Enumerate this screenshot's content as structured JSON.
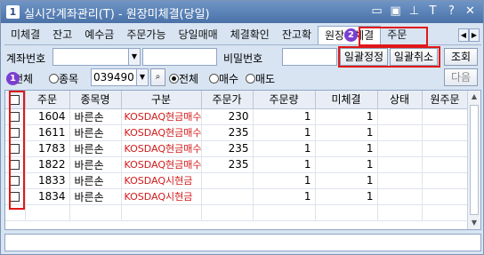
{
  "window": {
    "number": "1",
    "title": "실시간계좌관리(T) - 원장미체결(당일)",
    "title_icons": [
      "restore-icon",
      "dock-icon",
      "pin-icon",
      "font-icon",
      "help-icon",
      "close-icon"
    ]
  },
  "tabs": [
    "미체결",
    "잔고",
    "예수금",
    "주문가능",
    "당일매매",
    "체결확인",
    "잔고확",
    "원장미체결",
    "주문"
  ],
  "active_tab": "원장미체결",
  "form": {
    "account_label": "계좌번호",
    "password_label": "비밀번호",
    "batch_correct": "일괄정정",
    "batch_cancel": "일괄취소",
    "query": "조회",
    "scope_all": "전체",
    "scope_item": "종목",
    "code_value": "039490",
    "side_all": "전체",
    "side_buy": "매수",
    "side_sell": "매도",
    "next": "다음"
  },
  "badges": {
    "one": "1",
    "two": "2"
  },
  "table": {
    "headers": [
      "주문",
      "종목명",
      "구분",
      "주문가",
      "주문량",
      "미체결",
      "상태",
      "원주문"
    ],
    "rows": [
      [
        "1604",
        "바른손",
        "KOSDAQ현금매수",
        "230",
        "1",
        "1",
        "",
        ""
      ],
      [
        "1611",
        "바른손",
        "KOSDAQ현금매수",
        "235",
        "1",
        "1",
        "",
        ""
      ],
      [
        "1783",
        "바른손",
        "KOSDAQ현금매수",
        "235",
        "1",
        "1",
        "",
        ""
      ],
      [
        "1822",
        "바른손",
        "KOSDAQ현금매수",
        "235",
        "1",
        "1",
        "",
        ""
      ],
      [
        "1833",
        "바른손",
        "KOSDAQ시현금",
        "",
        "1",
        "1",
        "",
        ""
      ],
      [
        "1834",
        "바른손",
        "KOSDAQ시현금",
        "",
        "1",
        "1",
        "",
        ""
      ]
    ]
  },
  "colors": {
    "accent_red": "#e01818",
    "sell_text": "#d41a1a",
    "badge": "#7b3fd0"
  }
}
